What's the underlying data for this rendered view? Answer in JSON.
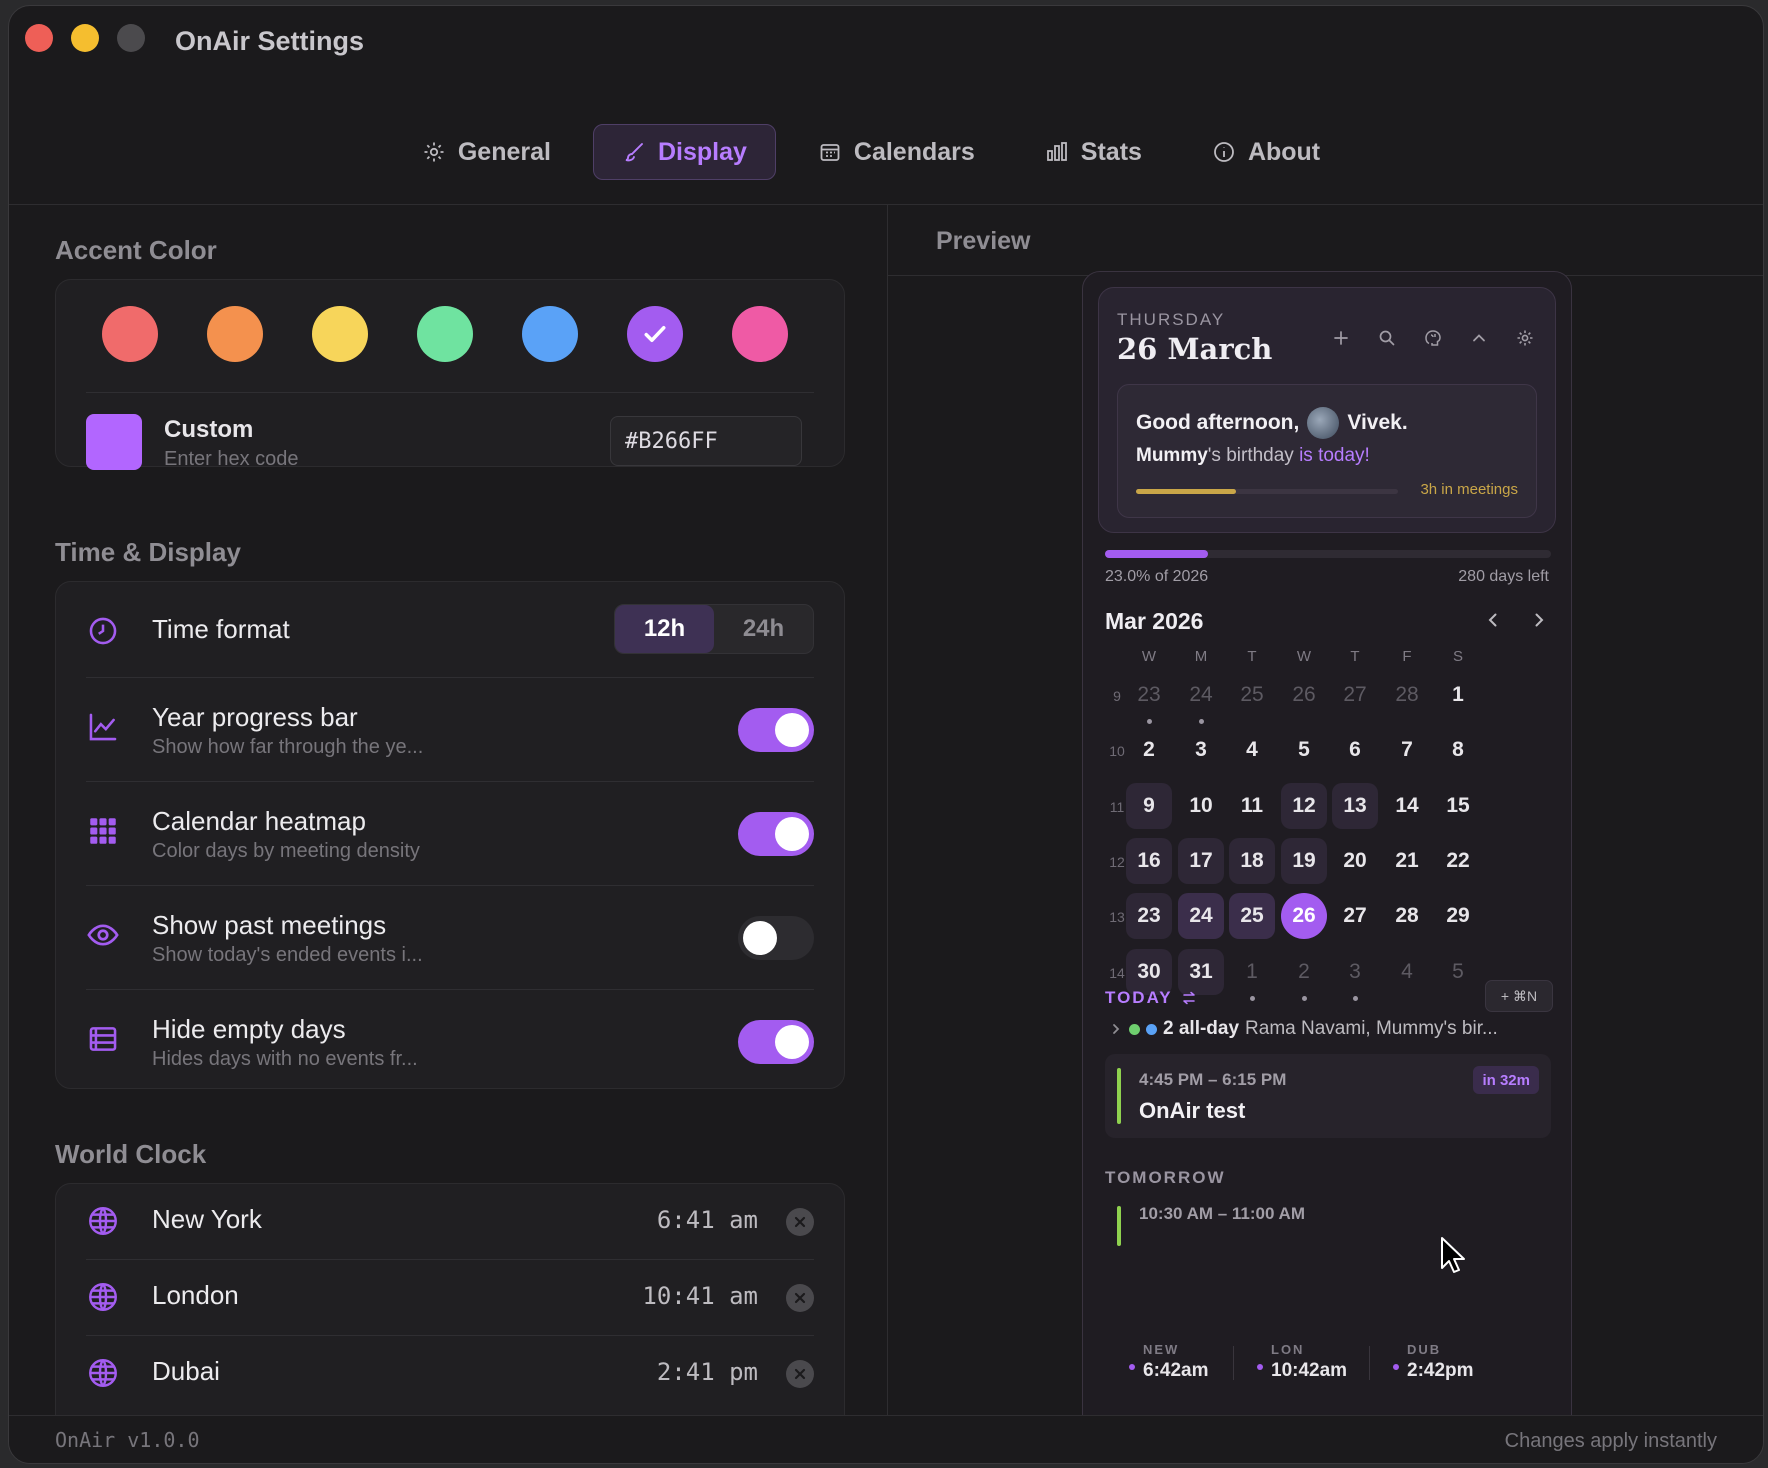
{
  "window": {
    "title": "OnAir Settings"
  },
  "tabs": [
    {
      "label": "General",
      "icon": "gear-icon"
    },
    {
      "label": "Display",
      "icon": "brush-icon",
      "active": true
    },
    {
      "label": "Calendars",
      "icon": "calendar-icon"
    },
    {
      "label": "Stats",
      "icon": "bar-chart-icon"
    },
    {
      "label": "About",
      "icon": "info-icon"
    }
  ],
  "accent": {
    "section_title": "Accent Color",
    "swatches": [
      "#f06b6b",
      "#f4914e",
      "#f7d55a",
      "#6fe3a0",
      "#5aa2f7",
      "#a35cf0",
      "#ef5aa5"
    ],
    "selected_color": "#a35cf0",
    "custom_label": "Custom",
    "custom_placeholder": "Enter hex code",
    "hex_value": "#B266FF",
    "custom_color": "#B266FF"
  },
  "time_display": {
    "section_title": "Time & Display",
    "time_format": {
      "label": "Time format",
      "options": [
        "12h",
        "24h"
      ],
      "selected": "12h"
    },
    "rows": [
      {
        "title": "Year progress bar",
        "subtitle": "Show how far through the ye...",
        "enabled": true
      },
      {
        "title": "Calendar heatmap",
        "subtitle": "Color days by meeting density",
        "enabled": true
      },
      {
        "title": "Show past meetings",
        "subtitle": "Show today's ended events i...",
        "enabled": false
      },
      {
        "title": "Hide empty days",
        "subtitle": "Hides days with no events fr...",
        "enabled": true
      }
    ]
  },
  "world_clock": {
    "section_title": "World Clock",
    "clocks": [
      {
        "city": "New York",
        "time": "6:41 am"
      },
      {
        "city": "London",
        "time": "10:41 am"
      },
      {
        "city": "Dubai",
        "time": "2:41 pm"
      }
    ]
  },
  "preview": {
    "label": "Preview",
    "day_name": "THURSDAY",
    "date": "26 March",
    "greeting_prefix": "Good afternoon,",
    "greeting_name": "Vivek.",
    "birthday_name": "Mummy",
    "birthday_text": "'s birthday ",
    "birthday_highlight": "is today!",
    "meetings_progress": 0.38,
    "meetings_label": "3h in meetings",
    "year_progress": 0.23,
    "year_label": "23.0% of 2026",
    "days_left": "280 days left",
    "month_title": "Mar 2026",
    "weekdays": [
      "W",
      "M",
      "T",
      "W",
      "T",
      "F",
      "S"
    ],
    "weeks": [
      {
        "wk": "9",
        "days": [
          [
            "23",
            "muted",
            "dot"
          ],
          [
            "24",
            "muted",
            "dot"
          ],
          [
            "25",
            "muted",
            ""
          ],
          [
            "26",
            "muted",
            ""
          ],
          [
            "27",
            "muted",
            ""
          ],
          [
            "28",
            "muted",
            ""
          ],
          [
            "1",
            "",
            ""
          ]
        ]
      },
      {
        "wk": "10",
        "days": [
          [
            "2",
            "",
            ""
          ],
          [
            "3",
            "",
            ""
          ],
          [
            "4",
            "",
            ""
          ],
          [
            "5",
            "",
            ""
          ],
          [
            "6",
            "",
            ""
          ],
          [
            "7",
            "",
            ""
          ],
          [
            "8",
            "",
            ""
          ]
        ]
      },
      {
        "wk": "11",
        "days": [
          [
            "9",
            "h1",
            ""
          ],
          [
            "10",
            "",
            ""
          ],
          [
            "11",
            "",
            ""
          ],
          [
            "12",
            "h1",
            ""
          ],
          [
            "13",
            "h1",
            ""
          ],
          [
            "14",
            "",
            ""
          ],
          [
            "15",
            "",
            ""
          ]
        ]
      },
      {
        "wk": "12",
        "days": [
          [
            "16",
            "h1",
            ""
          ],
          [
            "17",
            "h1",
            ""
          ],
          [
            "18",
            "h1",
            ""
          ],
          [
            "19",
            "h1",
            ""
          ],
          [
            "20",
            "",
            ""
          ],
          [
            "21",
            "",
            ""
          ],
          [
            "22",
            "",
            ""
          ]
        ]
      },
      {
        "wk": "13",
        "days": [
          [
            "23",
            "h1",
            ""
          ],
          [
            "24",
            "h2",
            ""
          ],
          [
            "25",
            "h2",
            ""
          ],
          [
            "26",
            "today",
            ""
          ],
          [
            "27",
            "",
            ""
          ],
          [
            "28",
            "",
            ""
          ],
          [
            "29",
            "",
            ""
          ]
        ]
      },
      {
        "wk": "14",
        "days": [
          [
            "30",
            "h1",
            ""
          ],
          [
            "31",
            "h1",
            ""
          ],
          [
            "1",
            "muted",
            "dot"
          ],
          [
            "2",
            "muted",
            "dot"
          ],
          [
            "3",
            "muted",
            "dot"
          ],
          [
            "4",
            "muted",
            ""
          ],
          [
            "5",
            "muted",
            ""
          ]
        ]
      }
    ],
    "today_label": "TODAY",
    "quick_add": "+ ⌘N",
    "allday_count": "2 all-day",
    "allday_names": "Rama Navami, Mummy's bir...",
    "allday_dot_colors": [
      "#6fcf6f",
      "#5aa2f7"
    ],
    "event": {
      "time": "4:45 PM – 6:15 PM",
      "title": "OnAir test",
      "badge": "in 32m"
    },
    "tomorrow_label": "TOMORROW",
    "event2_time": "10:30 AM – 11:00 AM",
    "world": [
      {
        "code": "NEW",
        "time": "6:42am"
      },
      {
        "code": "LON",
        "time": "10:42am"
      },
      {
        "code": "DUB",
        "time": "2:42pm"
      }
    ]
  },
  "footer": {
    "version": "OnAir v1.0.0",
    "status": "Changes apply instantly"
  }
}
